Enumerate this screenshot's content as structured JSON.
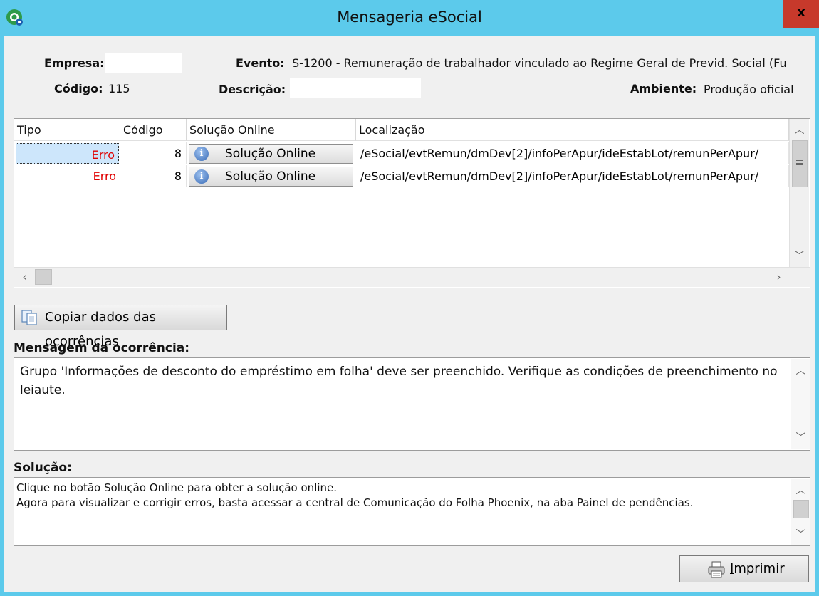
{
  "window": {
    "title": "Mensageria eSocial",
    "close_label": "x"
  },
  "header": {
    "empresa_label": "Empresa:",
    "empresa_value": "",
    "evento_label": "Evento:",
    "evento_value": "S-1200 - Remuneração de trabalhador vinculado ao Regime Geral de Previd. Social (Fu",
    "codigo_label": "Código:",
    "codigo_value": "115",
    "descricao_label": "Descrição:",
    "descricao_value": "",
    "ambiente_label": "Ambiente:",
    "ambiente_value": "Produção oficial"
  },
  "grid": {
    "columns": [
      "Tipo",
      "Código",
      "Solução Online",
      "Localização"
    ],
    "rows": [
      {
        "tipo": "Erro",
        "codigo": "8",
        "solucao": "Solução Online",
        "localizacao": "/eSocial/evtRemun/dmDev[2]/infoPerApur/ideEstabLot/remunPerApur/"
      },
      {
        "tipo": "Erro",
        "codigo": "8",
        "solucao": "Solução Online",
        "localizacao": "/eSocial/evtRemun/dmDev[2]/infoPerApur/ideEstabLot/remunPerApur/"
      }
    ]
  },
  "copy_button": {
    "label": "Copiar dados das ocorrências"
  },
  "mensagem": {
    "label": "Mensagem da ocorrência:",
    "text": "Grupo 'Informações de desconto do empréstimo em folha' deve ser preenchido. Verifique as condições de preenchimento no leiaute."
  },
  "solucao": {
    "label": "Solução:",
    "line1": "Clique no botão Solução Online para obter a solução online.",
    "line2": "Agora para visualizar e corrigir erros, basta acessar a central de Comunicação do Folha Phoenix, na aba Painel de pendências."
  },
  "print_button": {
    "label_underlined": "I",
    "label_rest": "mprimir"
  },
  "icons": {
    "app": "app-logo-icon",
    "info": "info-icon",
    "copy": "copy-icon",
    "printer": "printer-icon"
  }
}
